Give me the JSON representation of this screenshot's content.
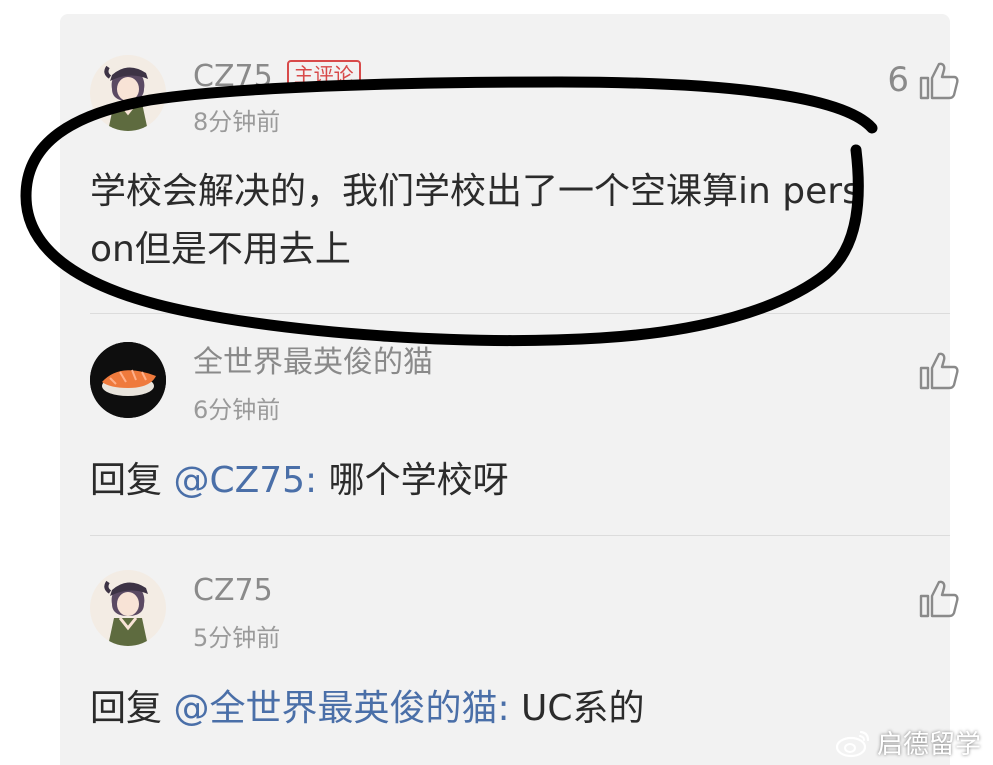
{
  "comments": [
    {
      "username": "CZ75",
      "badge": "主评论",
      "time": "8分钟前",
      "like_count": "6",
      "text": "学校会解决的，我们学校出了一个空课算in person但是不用去上"
    },
    {
      "username": "全世界最英俊的猫",
      "time": "6分钟前",
      "reply_prefix": "回复 ",
      "mention": "@CZ75:",
      "text": " 哪个学校呀"
    },
    {
      "username": "CZ75",
      "time": "5分钟前",
      "reply_prefix": "回复 ",
      "mention": "@全世界最英俊的猫:",
      "text": " UC系的"
    }
  ],
  "watermark": "启德留学",
  "icons": {
    "like": "thumbs-up-icon",
    "weibo": "weibo-icon"
  },
  "colors": {
    "background": "#f2f2f2",
    "mention": "#4a6fa8",
    "badge": "#d84a4a",
    "annotation": "#000000"
  }
}
